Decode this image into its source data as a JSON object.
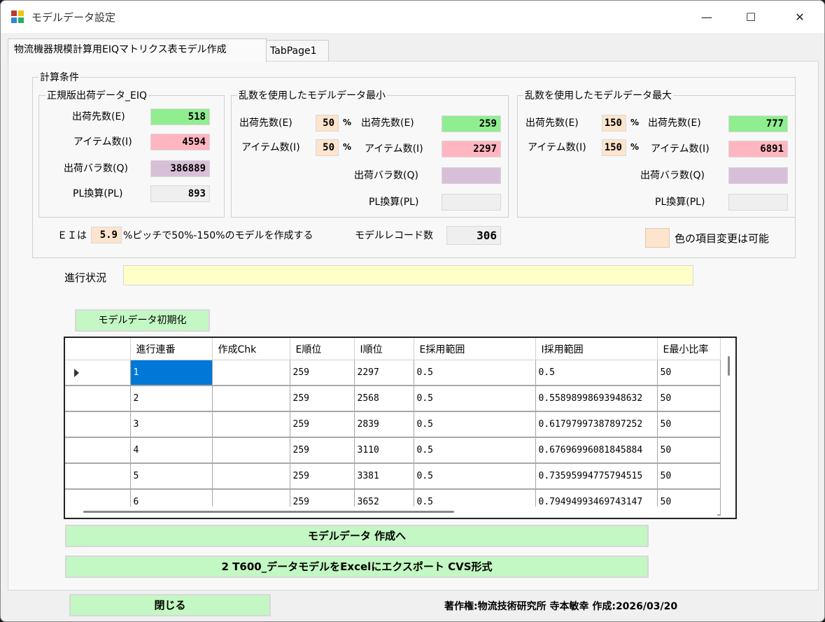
{
  "window": {
    "title": "モデルデータ設定",
    "minimize": "—",
    "maximize": "☐",
    "close": "✕"
  },
  "tabs": [
    "物流機器規模計算用EIQマトリクス表モデル作成",
    "TabPage1"
  ],
  "calc": {
    "title": "計算条件",
    "regular": {
      "title": "正規版出荷データ_EIQ",
      "e_label": "出荷先数(E)",
      "e_value": "518",
      "i_label": "アイテム数(I)",
      "i_value": "4594",
      "q_label": "出荷バラ数(Q)",
      "q_value": "386889",
      "pl_label": "PL換算(PL)",
      "pl_value": "893"
    },
    "min": {
      "title": "乱数を使用したモデルデータ最小",
      "e_pct_label": "出荷先数(E)",
      "e_pct": "50",
      "pct_sign": "%",
      "i_pct_label": "アイテム数(I)",
      "i_pct": "50",
      "e_label": "出荷先数(E)",
      "e_value": "259",
      "i_label": "アイテム数(I)",
      "i_value": "2297",
      "q_label": "出荷バラ数(Q)",
      "q_value": "",
      "pl_label": "PL換算(PL)",
      "pl_value": ""
    },
    "max": {
      "title": "乱数を使用したモデルデータ最大",
      "e_pct_label": "出荷先数(E)",
      "e_pct": "150",
      "pct_sign": "%",
      "i_pct_label": "アイテム数(I)",
      "i_pct": "150",
      "e_label": "出荷先数(E)",
      "e_value": "777",
      "i_label": "アイテム数(I)",
      "i_value": "6891",
      "q_label": "出荷バラ数(Q)",
      "q_value": "",
      "pl_label": "PL換算(PL)",
      "pl_value": ""
    },
    "ei_prefix": "ＥＩは",
    "ei_pitch": "5.9",
    "ei_suffix": "%ピッチで50%-150%のモデルを作成する",
    "record_label": "モデルレコード数",
    "record_value": "306",
    "legend_text": "色の項目変更は可能"
  },
  "progress": {
    "label": "進行状況",
    "value": ""
  },
  "buttons": {
    "init": "モデルデータ初期化",
    "create": "モデルデータ 作成へ",
    "export": "2 T600_データモデルをExcelにエクスポート CVS形式",
    "close": "閉じる"
  },
  "grid": {
    "columns": [
      "進行連番",
      "作成Chk",
      "E順位",
      "I順位",
      "E採用範囲",
      "I採用範囲",
      "E最小比率"
    ],
    "rows": [
      [
        "1",
        "",
        "259",
        "2297",
        "0.5",
        "0.5",
        "50"
      ],
      [
        "2",
        "",
        "259",
        "2568",
        "0.5",
        "0.55898998693948632",
        "50"
      ],
      [
        "3",
        "",
        "259",
        "2839",
        "0.5",
        "0.61797997387897252",
        "50"
      ],
      [
        "4",
        "",
        "259",
        "3110",
        "0.5",
        "0.67696996081845884",
        "50"
      ],
      [
        "5",
        "",
        "259",
        "3381",
        "0.5",
        "0.73595994775794515",
        "50"
      ],
      [
        "6",
        "",
        "259",
        "3652",
        "0.5",
        "0.79494993469743147",
        "50"
      ]
    ]
  },
  "footer": {
    "copyright": "著作権:物流技術研究所 寺本敏幸 作成:2026/03/20"
  },
  "colors": {
    "green": "#90ee90",
    "pink": "#ffb6c1",
    "violet": "#d8bfd8",
    "peach": "#fde4cc",
    "yellow": "#ffffc8",
    "button": "#c3f7c3",
    "selection": "#0078d7"
  }
}
